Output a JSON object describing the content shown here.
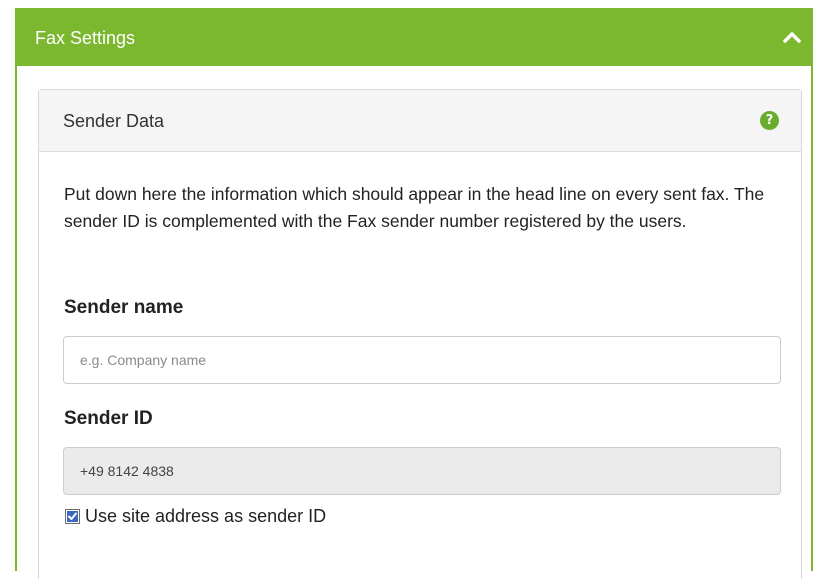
{
  "fax_settings": {
    "title": "Fax Settings",
    "collapse_icon": "chevron-up-icon",
    "header_color": "#7cb82f"
  },
  "sender_data": {
    "title": "Sender Data",
    "help_icon": "question-circle-icon",
    "help_symbol": "?",
    "description": "Put down here the information which should appear in the head line on every sent fax. The sender ID is complemented with the Fax sender number registered by the users.",
    "sender_name": {
      "label": "Sender name",
      "value": "",
      "placeholder": "e.g. Company name"
    },
    "sender_id": {
      "label": "Sender ID",
      "value": "+49 8142 4838",
      "disabled": true
    },
    "use_site_address": {
      "label": "Use site address as sender ID",
      "checked": true
    }
  }
}
